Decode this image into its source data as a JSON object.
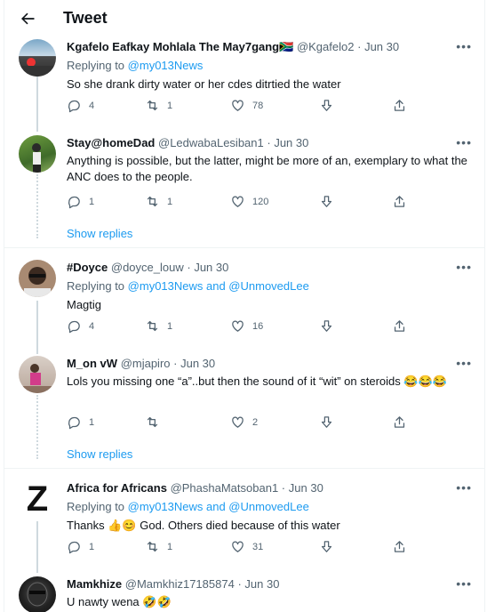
{
  "header": {
    "title": "Tweet"
  },
  "tweets": [
    {
      "name": "Kgafelo Eafkay Mohlala The May7gang",
      "flag": "🇿🇦",
      "handle": "@Kgafelo2",
      "sep": "·",
      "date": "Jun 30",
      "replying_prefix": "Replying to",
      "replying_to": "@my013News",
      "text": "So she drank dirty water or her cdes ditrtied the water",
      "replies": "4",
      "retweets": "1",
      "likes": "78"
    },
    {
      "name": "Stay@homeDad",
      "handle": "@LedwabaLesiban1",
      "sep": "·",
      "date": "Jun 30",
      "text": "Anything is possible, but the latter, might be more of an, exemplary to what the ANC does to the people.",
      "replies": "1",
      "retweets": "1",
      "likes": "120"
    },
    {
      "name": "#Doyce",
      "handle": "@doyce_louw",
      "sep": "·",
      "date": "Jun 30",
      "replying_prefix": "Replying to",
      "replying_to": "@my013News and @UnmovedLee",
      "text": "Magtig",
      "replies": "4",
      "retweets": "1",
      "likes": "16"
    },
    {
      "name": "M_on vW",
      "handle": "@mjapiro",
      "sep": "·",
      "date": "Jun 30",
      "text": "Lols you missing one “a”..but then the sound of it “wit” on steroids 😂😂😂",
      "replies": "1",
      "retweets": "",
      "likes": "2"
    },
    {
      "name": "Africa for Africans",
      "handle": "@PhashaMatsoban1",
      "sep": "·",
      "date": "Jun 30",
      "replying_prefix": "Replying to",
      "replying_to": "@my013News and @UnmovedLee",
      "text": "Thanks 👍😊 God. Others died because of this water",
      "replies": "1",
      "retweets": "1",
      "likes": "31"
    },
    {
      "name": "Mamkhize",
      "handle": "@Mamkhiz17185874",
      "sep": "·",
      "date": "Jun 30",
      "text": "U nawty wena 🤣🤣"
    }
  ],
  "show_replies": [
    "Show replies",
    "Show replies"
  ],
  "avatar_letter": "Z",
  "colors": {
    "accent": "#1d9bf0",
    "muted": "#536471",
    "text": "#0f1419",
    "line": "#cfd9de"
  },
  "icons": {
    "back": "arrow-left-icon",
    "reply": "reply-icon",
    "retweet": "retweet-icon",
    "like": "heart-icon",
    "vote": "arrow-down-icon",
    "share": "share-icon",
    "more": "more-icon"
  }
}
